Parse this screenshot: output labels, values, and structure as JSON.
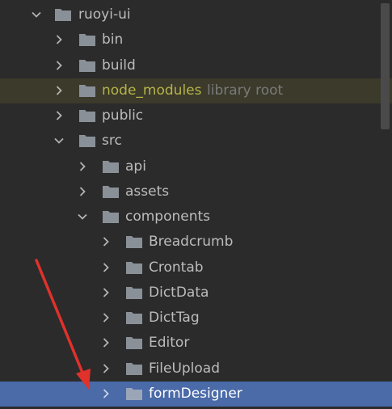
{
  "tree": {
    "items": [
      {
        "label": "ruoyi-ui",
        "expanded": true
      },
      {
        "label": "bin",
        "expanded": false
      },
      {
        "label": "build",
        "expanded": false
      },
      {
        "label": "node_modules",
        "expanded": false,
        "hint": "library root"
      },
      {
        "label": "public",
        "expanded": false
      },
      {
        "label": "src",
        "expanded": true
      },
      {
        "label": "api",
        "expanded": false
      },
      {
        "label": "assets",
        "expanded": false
      },
      {
        "label": "components",
        "expanded": true
      },
      {
        "label": "Breadcrumb",
        "expanded": false
      },
      {
        "label": "Crontab",
        "expanded": false
      },
      {
        "label": "DictData",
        "expanded": false
      },
      {
        "label": "DictTag",
        "expanded": false
      },
      {
        "label": "Editor",
        "expanded": false
      },
      {
        "label": "FileUpload",
        "expanded": false
      },
      {
        "label": "formDesigner",
        "expanded": false,
        "selected": true
      }
    ]
  },
  "colors": {
    "background": "#2b2b2b",
    "selected_row": "#4a6aa8",
    "library_row": "#3b3a2b",
    "library_text": "#b7b44a",
    "text": "#bcbcbc",
    "hint_text": "#7a7a7a",
    "folder": "#8a9097",
    "annotation_arrow": "#e0312b"
  },
  "icons": {
    "expanded": "chevron-down-icon",
    "collapsed": "chevron-right-icon",
    "folder": "folder-icon"
  }
}
